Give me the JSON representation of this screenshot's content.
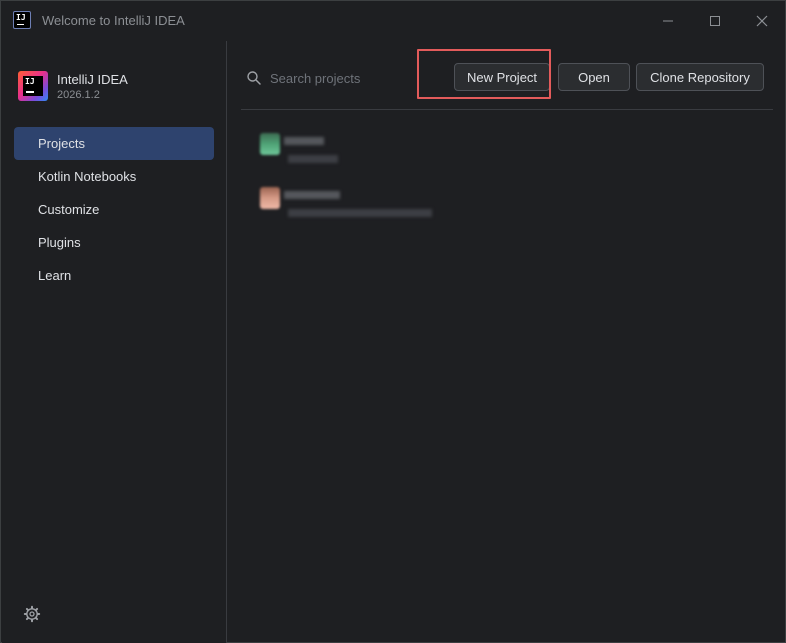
{
  "window": {
    "title": "Welcome to IntelliJ IDEA",
    "icon": "intellij-icon"
  },
  "sidebar": {
    "app_name": "IntelliJ IDEA",
    "version": "2026.1.2",
    "items": [
      {
        "label": "Projects",
        "active": true
      },
      {
        "label": "Kotlin Notebooks",
        "active": false
      },
      {
        "label": "Customize",
        "active": false
      },
      {
        "label": "Plugins",
        "active": false
      },
      {
        "label": "Learn",
        "active": false
      }
    ],
    "settings_icon": "gear-icon"
  },
  "main": {
    "search": {
      "placeholder": "Search projects",
      "value": ""
    },
    "buttons": {
      "new_project": "New Project",
      "open": "Open",
      "clone_repository": "Clone Repository"
    },
    "highlighted_button": "New Project",
    "projects_note": "two recent projects, names and paths blurred"
  },
  "colors": {
    "background": "#1e1f22",
    "active_nav": "#2e436e",
    "highlight_box": "#e35b5b",
    "project1_icon": "#4fa376",
    "project2_icon": "#d59a86"
  }
}
